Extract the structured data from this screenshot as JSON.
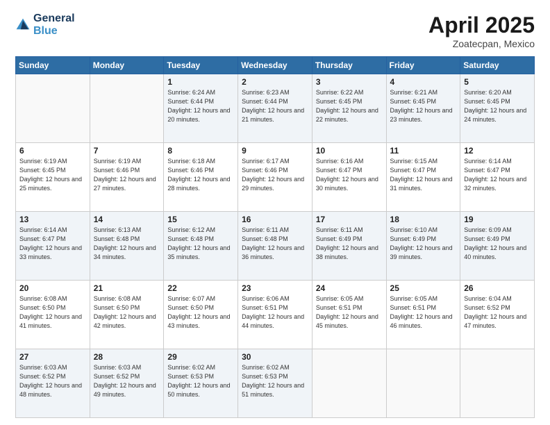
{
  "logo": {
    "line1": "General",
    "line2": "Blue"
  },
  "title": "April 2025",
  "subtitle": "Zoatecpan, Mexico",
  "weekdays": [
    "Sunday",
    "Monday",
    "Tuesday",
    "Wednesday",
    "Thursday",
    "Friday",
    "Saturday"
  ],
  "weeks": [
    [
      {
        "day": "",
        "detail": ""
      },
      {
        "day": "",
        "detail": ""
      },
      {
        "day": "1",
        "detail": "Sunrise: 6:24 AM\nSunset: 6:44 PM\nDaylight: 12 hours and 20 minutes."
      },
      {
        "day": "2",
        "detail": "Sunrise: 6:23 AM\nSunset: 6:44 PM\nDaylight: 12 hours and 21 minutes."
      },
      {
        "day": "3",
        "detail": "Sunrise: 6:22 AM\nSunset: 6:45 PM\nDaylight: 12 hours and 22 minutes."
      },
      {
        "day": "4",
        "detail": "Sunrise: 6:21 AM\nSunset: 6:45 PM\nDaylight: 12 hours and 23 minutes."
      },
      {
        "day": "5",
        "detail": "Sunrise: 6:20 AM\nSunset: 6:45 PM\nDaylight: 12 hours and 24 minutes."
      }
    ],
    [
      {
        "day": "6",
        "detail": "Sunrise: 6:19 AM\nSunset: 6:45 PM\nDaylight: 12 hours and 25 minutes."
      },
      {
        "day": "7",
        "detail": "Sunrise: 6:19 AM\nSunset: 6:46 PM\nDaylight: 12 hours and 27 minutes."
      },
      {
        "day": "8",
        "detail": "Sunrise: 6:18 AM\nSunset: 6:46 PM\nDaylight: 12 hours and 28 minutes."
      },
      {
        "day": "9",
        "detail": "Sunrise: 6:17 AM\nSunset: 6:46 PM\nDaylight: 12 hours and 29 minutes."
      },
      {
        "day": "10",
        "detail": "Sunrise: 6:16 AM\nSunset: 6:47 PM\nDaylight: 12 hours and 30 minutes."
      },
      {
        "day": "11",
        "detail": "Sunrise: 6:15 AM\nSunset: 6:47 PM\nDaylight: 12 hours and 31 minutes."
      },
      {
        "day": "12",
        "detail": "Sunrise: 6:14 AM\nSunset: 6:47 PM\nDaylight: 12 hours and 32 minutes."
      }
    ],
    [
      {
        "day": "13",
        "detail": "Sunrise: 6:14 AM\nSunset: 6:47 PM\nDaylight: 12 hours and 33 minutes."
      },
      {
        "day": "14",
        "detail": "Sunrise: 6:13 AM\nSunset: 6:48 PM\nDaylight: 12 hours and 34 minutes."
      },
      {
        "day": "15",
        "detail": "Sunrise: 6:12 AM\nSunset: 6:48 PM\nDaylight: 12 hours and 35 minutes."
      },
      {
        "day": "16",
        "detail": "Sunrise: 6:11 AM\nSunset: 6:48 PM\nDaylight: 12 hours and 36 minutes."
      },
      {
        "day": "17",
        "detail": "Sunrise: 6:11 AM\nSunset: 6:49 PM\nDaylight: 12 hours and 38 minutes."
      },
      {
        "day": "18",
        "detail": "Sunrise: 6:10 AM\nSunset: 6:49 PM\nDaylight: 12 hours and 39 minutes."
      },
      {
        "day": "19",
        "detail": "Sunrise: 6:09 AM\nSunset: 6:49 PM\nDaylight: 12 hours and 40 minutes."
      }
    ],
    [
      {
        "day": "20",
        "detail": "Sunrise: 6:08 AM\nSunset: 6:50 PM\nDaylight: 12 hours and 41 minutes."
      },
      {
        "day": "21",
        "detail": "Sunrise: 6:08 AM\nSunset: 6:50 PM\nDaylight: 12 hours and 42 minutes."
      },
      {
        "day": "22",
        "detail": "Sunrise: 6:07 AM\nSunset: 6:50 PM\nDaylight: 12 hours and 43 minutes."
      },
      {
        "day": "23",
        "detail": "Sunrise: 6:06 AM\nSunset: 6:51 PM\nDaylight: 12 hours and 44 minutes."
      },
      {
        "day": "24",
        "detail": "Sunrise: 6:05 AM\nSunset: 6:51 PM\nDaylight: 12 hours and 45 minutes."
      },
      {
        "day": "25",
        "detail": "Sunrise: 6:05 AM\nSunset: 6:51 PM\nDaylight: 12 hours and 46 minutes."
      },
      {
        "day": "26",
        "detail": "Sunrise: 6:04 AM\nSunset: 6:52 PM\nDaylight: 12 hours and 47 minutes."
      }
    ],
    [
      {
        "day": "27",
        "detail": "Sunrise: 6:03 AM\nSunset: 6:52 PM\nDaylight: 12 hours and 48 minutes."
      },
      {
        "day": "28",
        "detail": "Sunrise: 6:03 AM\nSunset: 6:52 PM\nDaylight: 12 hours and 49 minutes."
      },
      {
        "day": "29",
        "detail": "Sunrise: 6:02 AM\nSunset: 6:53 PM\nDaylight: 12 hours and 50 minutes."
      },
      {
        "day": "30",
        "detail": "Sunrise: 6:02 AM\nSunset: 6:53 PM\nDaylight: 12 hours and 51 minutes."
      },
      {
        "day": "",
        "detail": ""
      },
      {
        "day": "",
        "detail": ""
      },
      {
        "day": "",
        "detail": ""
      }
    ]
  ]
}
